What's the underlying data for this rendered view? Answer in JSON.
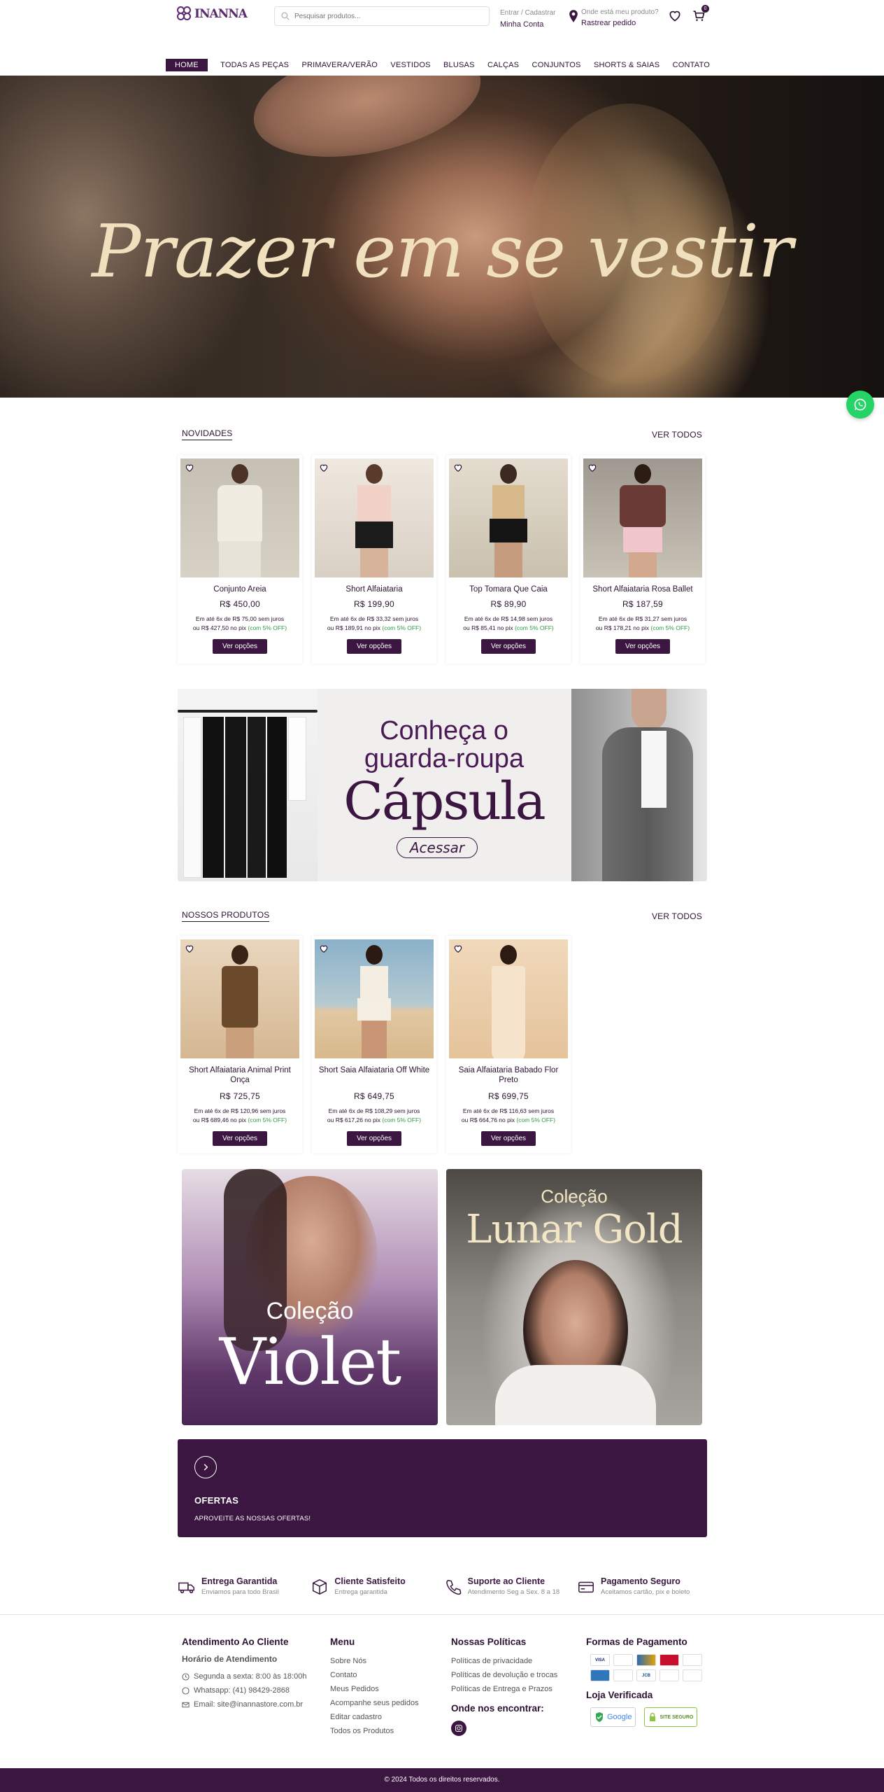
{
  "header": {
    "logo_text": "INANNA",
    "search_placeholder": "Pesquisar produtos...",
    "account_small": "Entrar / Cadastrar",
    "account_big": "Minha Conta",
    "track_small": "Onde está meu produto?",
    "track_big": "Rastrear pedido",
    "cart_count": "0"
  },
  "nav": [
    "HOME",
    "TODAS AS PEÇAS",
    "PRIMAVERA/VERÃO",
    "VESTIDOS",
    "BLUSAS",
    "CALÇAS",
    "CONJUNTOS",
    "SHORTS & SAIAS",
    "CONTATO"
  ],
  "hero": {
    "headline": "Prazer em se vestir"
  },
  "novidades": {
    "title": "NOVIDADES",
    "more": "VER TODOS",
    "products": [
      {
        "name": "Conjunto Areia",
        "price": "R$ 450,00",
        "inst_a": "Em até 6x de R$ 75,00 sem juros",
        "inst_b": "ou R$ 427,50 no pix",
        "pix": "(com 5% OFF)",
        "button": "Ver opções"
      },
      {
        "name": "Short Alfaiataria",
        "price": "R$ 199,90",
        "inst_a": "Em até 6x de R$ 33,32 sem juros",
        "inst_b": "ou R$ 189,91 no pix",
        "pix": "(com 5% OFF)",
        "button": "Ver opções"
      },
      {
        "name": "Top Tomara Que Caia",
        "price": "R$ 89,90",
        "inst_a": "Em até 6x de R$ 14,98 sem juros",
        "inst_b": "ou R$ 85,41 no pix",
        "pix": "(com 5% OFF)",
        "button": "Ver opções"
      },
      {
        "name": "Short Alfaiataria Rosa Ballet",
        "price": "R$ 187,59",
        "inst_a": "Em até 6x de R$ 31,27 sem juros",
        "inst_b": "ou R$ 178,21 no pix",
        "pix": "(com 5% OFF)",
        "button": "Ver opções"
      }
    ]
  },
  "capsule": {
    "line1": "Conheça o",
    "line2": "guarda-roupa",
    "line3": "Cápsula",
    "cta": "Acessar"
  },
  "nossos": {
    "title": "NOSSOS PRODUTOS",
    "more": "VER TODOS",
    "products": [
      {
        "name": "Short Alfaiataria Animal Print Onça",
        "price": "R$ 725,75",
        "inst_a": "Em até 6x de R$ 120,96 sem juros",
        "inst_b": "ou R$ 689,46 no pix",
        "pix": "(com 5% OFF)",
        "button": "Ver opções"
      },
      {
        "name": "Short Saia Alfaiataria Off White",
        "price": "R$ 649,75",
        "inst_a": "Em até 6x de R$ 108,29 sem juros",
        "inst_b": "ou R$ 617,26 no pix",
        "pix": "(com 5% OFF)",
        "button": "Ver opções"
      },
      {
        "name": "Saia Alfaiataria Babado Flor Preto",
        "price": "R$ 699,75",
        "inst_a": "Em até 6x de R$ 116,63 sem juros",
        "inst_b": "ou R$ 664,76 no pix",
        "pix": "(com 5% OFF)",
        "button": "Ver opções"
      }
    ]
  },
  "collections": {
    "violet": {
      "l1": "Coleção",
      "l2": "Violet"
    },
    "lunar": {
      "l1": "Coleção",
      "l2": "Lunar Gold"
    }
  },
  "offers": {
    "title": "OFERTAS",
    "subtitle": "APROVEITE AS NOSSAS OFERTAS!"
  },
  "features": [
    {
      "icon": "truck-icon",
      "title": "Entrega Garantida",
      "sub": "Enviamos para todo Brasil"
    },
    {
      "icon": "box-icon",
      "title": "Cliente Satisfeito",
      "sub": "Entrega garantida"
    },
    {
      "icon": "phone-icon",
      "title": "Suporte ao Cliente",
      "sub": "Atendimento Seg a Sex. 8 a 18"
    },
    {
      "icon": "card-icon",
      "title": "Pagamento Seguro",
      "sub": "Aceitamos cartão, pix e boleto"
    }
  ],
  "footer": {
    "atend_title": "Atendimento Ao Cliente",
    "horario_title": "Horário de Atendimento",
    "horario": "Segunda a sexta: 8:00 às 18:00h",
    "whatsapp": "Whatsapp: (41) 98429-2868",
    "email": "Email: site@inannastore.com.br",
    "menu_title": "Menu",
    "menu": [
      "Sobre Nós",
      "Contato",
      "Meus Pedidos",
      "Acompanhe seus pedidos",
      "Editar cadastro",
      "Todos os Produtos"
    ],
    "politicas_title": "Nossas Políticas",
    "politicas": [
      "Políticas de privacidade",
      "Políticas de devolução e trocas",
      "Políticas de Entrega e Prazos"
    ],
    "encontrar_title": "Onde nos encontrar:",
    "pagamento_title": "Formas de Pagamento",
    "payments": [
      "VISA",
      "",
      "",
      "",
      "",
      "",
      "",
      "JCB",
      "",
      ""
    ],
    "verificada_title": "Loja Verificada",
    "seal_google": "Google",
    "seal_site": "SITE SEGURO",
    "copyright": "© 2024 Todos os direitos reservados."
  },
  "colors": {
    "brand": "#3a1640",
    "pix": "#2e9b45",
    "whatsapp": "#25d366"
  }
}
